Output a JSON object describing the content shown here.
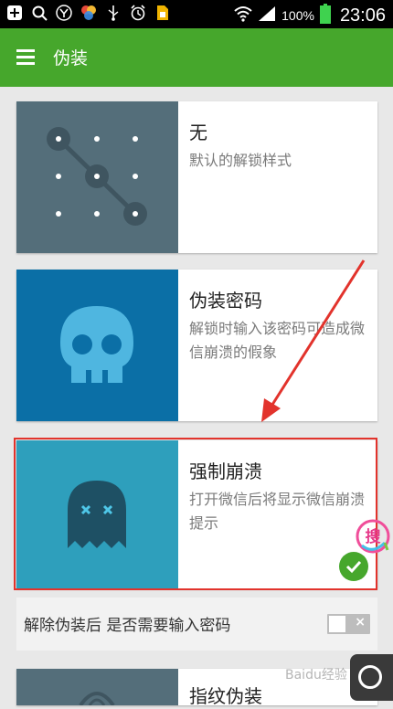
{
  "status_bar": {
    "battery_percent": "100%",
    "time": "23:06",
    "icons": [
      "add-icon",
      "search-notify-icon",
      "app-icon",
      "colorful-app-icon",
      "usb-icon",
      "alarm-icon",
      "sim-icon",
      "wifi-icon",
      "signal-icon",
      "battery-icon"
    ]
  },
  "app_bar": {
    "title": "伪装"
  },
  "options": [
    {
      "title": "无",
      "desc": "默认的解锁样式",
      "icon": "pattern-lock-icon",
      "color": "#546e7a"
    },
    {
      "title": "伪装密码",
      "desc": "解锁时输入该密码可造成微信崩溃的假象",
      "icon": "skull-icon",
      "color": "#0b6fa6"
    },
    {
      "title": "强制崩溃",
      "desc": "打开微信后将显示微信崩溃提示",
      "icon": "ghost-icon",
      "color": "#2e9fbc",
      "selected": true
    },
    {
      "title": "指纹伪装",
      "icon": "fingerprint-icon",
      "color": "#546e7a"
    }
  ],
  "toggle": {
    "label": "解除伪装后 是否需要输入密码",
    "state": "off",
    "off_symbol": "×"
  },
  "colors": {
    "accent": "#46a72c",
    "highlight_frame": "#e2332c"
  },
  "overlay": {
    "badge_text": "搜",
    "watermark": "Baidu经验"
  }
}
